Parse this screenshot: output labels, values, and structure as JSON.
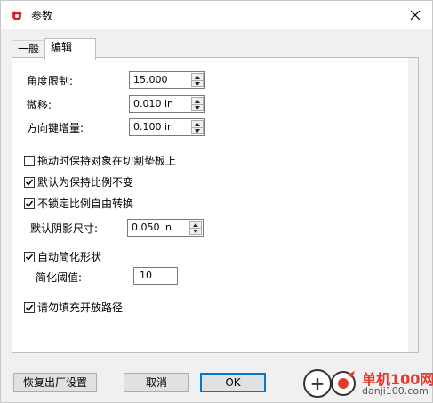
{
  "window": {
    "title": "参数",
    "accent": "#0078d7"
  },
  "tabs": [
    {
      "label": "一般",
      "active": false
    },
    {
      "label": "编辑",
      "active": true
    }
  ],
  "fields": {
    "angle_limit": {
      "label": "角度限制:",
      "value": "15.000"
    },
    "nudge": {
      "label": "微移:",
      "value": "0.010 in"
    },
    "arrow_increment": {
      "label": "方向键增量:",
      "value": "0.100 in"
    },
    "shadow_size": {
      "label": "默认阴影尺寸:",
      "value": "0.050 in"
    },
    "simplify_threshold": {
      "label": "简化阈值:",
      "value": "10"
    }
  },
  "checkboxes": {
    "keep_on_mat": {
      "label": "拖动时保持对象在切割垫板上",
      "checked": false
    },
    "keep_ratio": {
      "label": "默认为保持比例不变",
      "checked": true
    },
    "unlocked_free": {
      "label": "不锁定比例自由转换",
      "checked": true
    },
    "auto_simplify": {
      "label": "自动简化形状",
      "checked": true
    },
    "no_fill_open": {
      "label": "请勿填充开放路径",
      "checked": true
    }
  },
  "buttons": {
    "reset": "恢复出厂设置",
    "cancel": "取消",
    "ok": "OK"
  },
  "watermark": {
    "name": "单机100网",
    "url": "danji100.com"
  }
}
